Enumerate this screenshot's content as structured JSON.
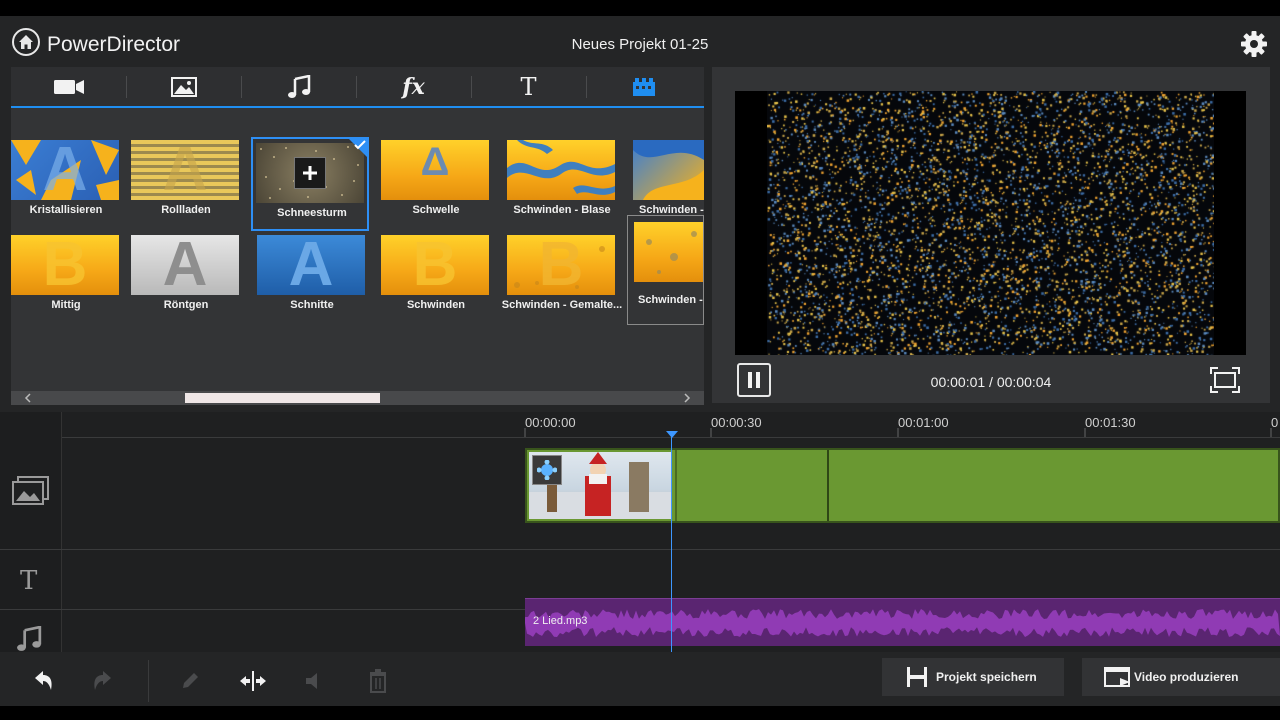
{
  "app": {
    "name": "PowerDirector",
    "project_title": "Neues Projekt 01-25"
  },
  "library": {
    "tabs": [
      {
        "name": "video-camera-icon",
        "active": false
      },
      {
        "name": "image-icon",
        "active": false
      },
      {
        "name": "music-note-icon",
        "active": false
      },
      {
        "name": "fx-icon",
        "label": "fx",
        "active": false
      },
      {
        "name": "title-text-icon",
        "label": "T",
        "active": false
      },
      {
        "name": "transition-icon",
        "active": true
      }
    ],
    "transitions": [
      {
        "label": "Kristallisieren",
        "letter": "A"
      },
      {
        "label": "Rollladen",
        "letter": "A"
      },
      {
        "label": "Schneesturm",
        "letter": ""
      },
      {
        "label": "Schwelle",
        "letter": "A"
      },
      {
        "label": "Schwinden - Blase",
        "letter": ""
      },
      {
        "label": "Schwinden -",
        "letter": ""
      },
      {
        "label": "Mittig",
        "letter": "B"
      },
      {
        "label": "Röntgen",
        "letter": "A"
      },
      {
        "label": "Schnitte",
        "letter": "A"
      },
      {
        "label": "Schwinden",
        "letter": "B"
      },
      {
        "label": "Schwinden - Gemalte...",
        "letter": "B"
      },
      {
        "label": "Schwinden - \\",
        "letter": ""
      }
    ],
    "selected_transition": "Schneesturm"
  },
  "preview": {
    "time_display": "00:00:01 / 00:00:04"
  },
  "timeline": {
    "ruler_ticks": [
      "00:00:00",
      "00:00:30",
      "00:01:00",
      "00:01:30",
      "0"
    ],
    "audio_clip_name": "2 Lied.mp3"
  },
  "toolbar": {
    "save_project_label": "Projekt speichern",
    "produce_video_label": "Video produzieren"
  },
  "colors": {
    "accent": "#2e8ff5",
    "video_clip": "#6a9832",
    "audio_clip": "#5a2571",
    "playhead": "#3d97ff"
  }
}
